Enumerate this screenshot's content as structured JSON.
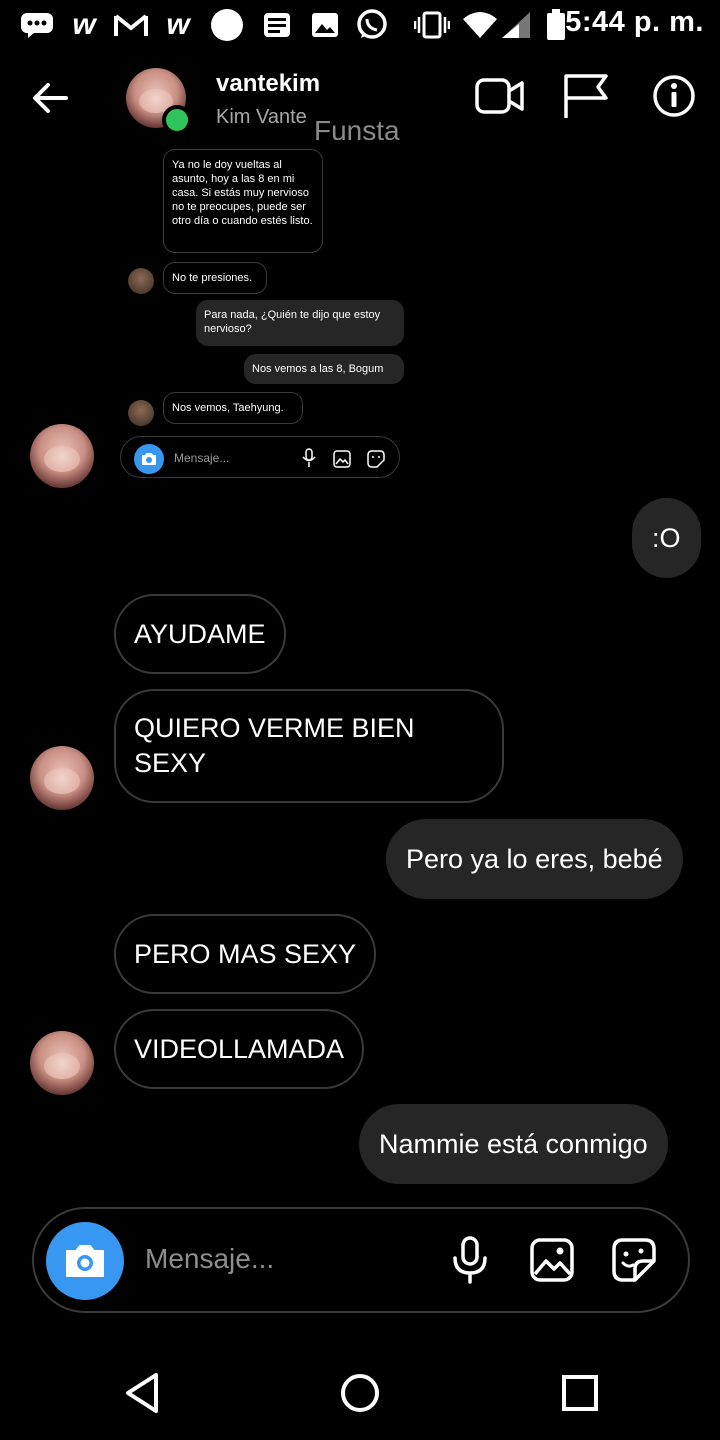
{
  "status_bar": {
    "time": "5:44 p. m.",
    "icons": [
      "chat-icon",
      "w-icon",
      "gmail-icon",
      "w-icon",
      "circle-icon",
      "news-icon",
      "gallery-icon",
      "whatsapp-icon",
      "vibrate-icon",
      "wifi-icon",
      "signal-icon",
      "battery-icon"
    ]
  },
  "header": {
    "username": "vantekim",
    "full_name": "Kim Vante",
    "watermark": "Funsta",
    "online": true,
    "icons": [
      "back-arrow-icon",
      "video-call-icon",
      "flag-icon",
      "info-icon"
    ]
  },
  "embedded_screenshot": {
    "messages": [
      {
        "from": "them",
        "text": "Ya no le doy vueltas al asunto, hoy a las 8 en mi casa. Si estás muy nervioso no te preocupes, puede ser otro día o cuando estés listo."
      },
      {
        "from": "them",
        "text": "No te presiones."
      },
      {
        "from": "me",
        "text": "Para nada, ¿Quién te dijo que estoy nervioso?"
      },
      {
        "from": "me",
        "text": "Nos vemos a las 8, Bogum"
      },
      {
        "from": "them",
        "text": "Nos vemos, Taehyung."
      }
    ],
    "input_placeholder": "Mensaje..."
  },
  "messages": [
    {
      "from": "me",
      "text": ":O"
    },
    {
      "from": "them",
      "text": "AYUDAME"
    },
    {
      "from": "them",
      "text": "QUIERO VERME BIEN SEXY"
    },
    {
      "from": "me",
      "text": "Pero ya lo eres, bebé"
    },
    {
      "from": "them",
      "text": "PERO MAS SEXY"
    },
    {
      "from": "them",
      "text": "VIDEOLLAMADA"
    },
    {
      "from": "me",
      "text": "Nammie está conmigo"
    }
  ],
  "composer": {
    "placeholder": "Mensaje...",
    "icons": [
      "camera-icon",
      "microphone-icon",
      "image-icon",
      "sticker-icon"
    ]
  },
  "nav_bar": {
    "icons": [
      "back-triangle-icon",
      "home-circle-icon",
      "recents-square-icon"
    ]
  },
  "colors": {
    "background": "#000000",
    "my_bubble": "#262626",
    "their_bubble_border": "#3a3a3a",
    "accent_blue": "#3897f0",
    "online_green": "#2ec55a"
  }
}
